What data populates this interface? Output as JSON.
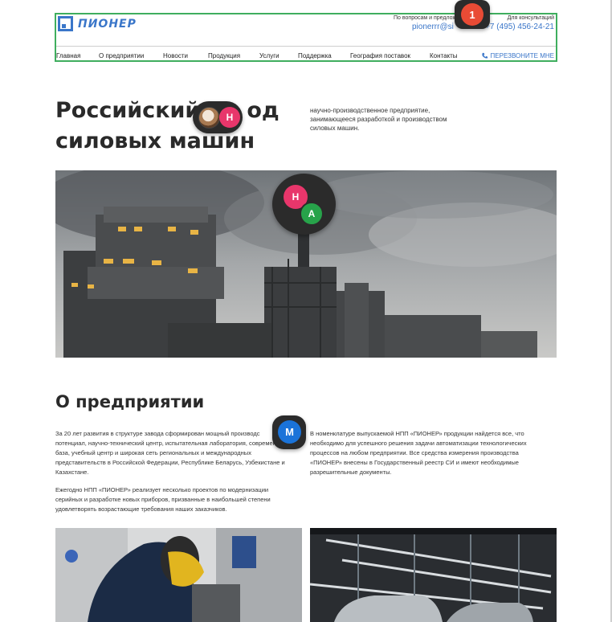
{
  "header": {
    "logo_text": "ПИОНЕР",
    "contact_question": "По вопросам и предложе",
    "email": "pionerrr@si",
    "consult_label": "Для консультаций",
    "phone": "+7 (495) 456-24-21",
    "callback": "ПЕРЕЗВОНИТЕ МНЕ",
    "nav": [
      "Главная",
      "О предприятии",
      "Новости",
      "Продукция",
      "Услуги",
      "Поддержка",
      "География поставок",
      "Контакты"
    ]
  },
  "notification": {
    "count": "1"
  },
  "hero": {
    "title_line1": "Российский",
    "title_line1b": "од",
    "title_line2": "силовых машин",
    "subtitle": "научно-производственное предприятие, занимающееся разработкой и производством силовых машин."
  },
  "avatars": {
    "h1": "Н",
    "h2": "Н",
    "a": "А",
    "m": "М"
  },
  "about": {
    "title": "О предприятии",
    "p1": "За 20 лет развития в структуре завода сформирован мощный производс потенциал, научно-технический центр, испытательная лаборатория, современная база, учебный центр и широкая сеть региональных и международных представительств в Российской Федерации, Республике Беларусь, Узбекистане и Казахстане.",
    "p2": "Ежегодно НПП «ПИОНЕР» реализует несколько проектов по модернизации серийных и разработке новых приборов, призванные в наибольшей степени удовлетворять возрастающие требования наших заказчиков.",
    "p3": "В номенклатуре выпускаемой НПП «ПИОНЕР» продукции найдется все, что необходимо для успешного решения задачи автоматизации технологических процессов на любом предприятии. Все средства измерения производства «ПИОНЕР» внесены в Государственный реестр СИ и имеют необходимые разрешительные документы."
  },
  "colors": {
    "brand": "#3a76c9",
    "header_outline": "#3fae5e",
    "badge": "#e94b35"
  }
}
